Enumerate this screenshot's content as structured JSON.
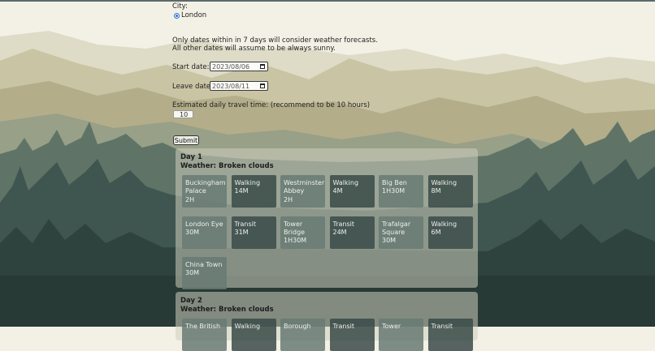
{
  "city": {
    "label": "City:",
    "option": "London",
    "selected": true
  },
  "notice": {
    "line1": "Only dates within in 7 days will consider weather forecasts.",
    "line2": "All other dates will assume to be always sunny."
  },
  "start_date": {
    "label": "Start date:",
    "value": "2023/08/06"
  },
  "leave_date": {
    "label": "Leave date:",
    "value": "2023/08/11"
  },
  "travel_time": {
    "label": "Estimated daily travel time: (recommend to be 10 hours)",
    "value": "10"
  },
  "submit_label": "Submit",
  "days": [
    {
      "title": "Day 1",
      "weather": "Weather: Broken clouds",
      "items": [
        {
          "kind": "attraction",
          "name": "Buckingham\nPalace",
          "duration": "2H"
        },
        {
          "kind": "transport",
          "name": "Walking",
          "duration": "14M"
        },
        {
          "kind": "attraction",
          "name": "Westminster\nAbbey",
          "duration": "2H"
        },
        {
          "kind": "transport",
          "name": "Walking",
          "duration": "4M"
        },
        {
          "kind": "attraction",
          "name": "Big Ben",
          "duration": "1H30M"
        },
        {
          "kind": "transport",
          "name": "Walking",
          "duration": "8M"
        },
        {
          "kind": "attraction",
          "name": "London Eye",
          "duration": "30M"
        },
        {
          "kind": "transport",
          "name": "Transit",
          "duration": "31M"
        },
        {
          "kind": "attraction",
          "name": "Tower\nBridge",
          "duration": "1H30M"
        },
        {
          "kind": "transport",
          "name": "Transit",
          "duration": "24M"
        },
        {
          "kind": "attraction",
          "name": "Trafalgar\nSquare",
          "duration": "30M"
        },
        {
          "kind": "transport",
          "name": "Walking",
          "duration": "6M"
        },
        {
          "kind": "attraction",
          "name": "China Town",
          "duration": "30M"
        }
      ]
    },
    {
      "title": "Day 2",
      "weather": "Weather: Broken clouds",
      "items": [
        {
          "kind": "attraction",
          "name": "The British",
          "duration": ""
        },
        {
          "kind": "transport",
          "name": "Walking",
          "duration": ""
        },
        {
          "kind": "attraction",
          "name": "Borough",
          "duration": ""
        },
        {
          "kind": "transport",
          "name": "Transit",
          "duration": ""
        },
        {
          "kind": "attraction",
          "name": "Tower",
          "duration": ""
        },
        {
          "kind": "transport",
          "name": "Transit",
          "duration": ""
        }
      ]
    }
  ],
  "colors": {
    "attraction_tile": "#677a73",
    "transport_tile": "#3a4a48",
    "day_panel": "#cdcdbe",
    "radio_accent": "#2b6fd6"
  }
}
